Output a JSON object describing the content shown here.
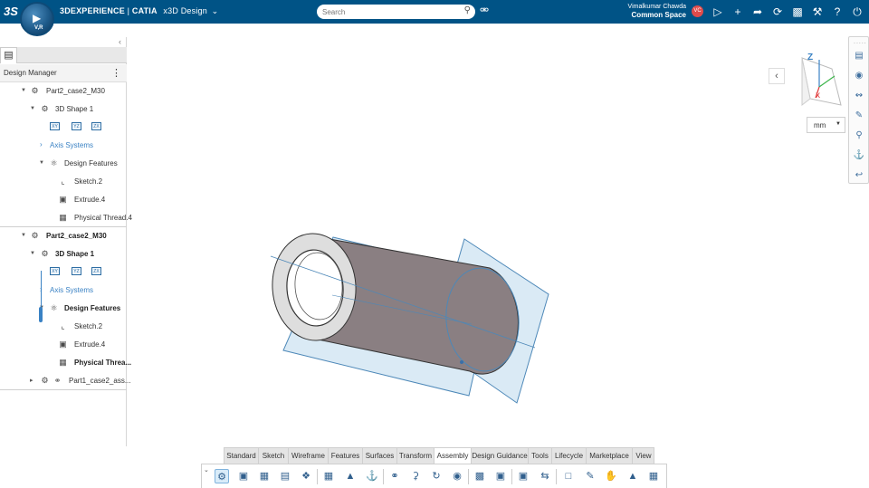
{
  "topbar": {
    "brand_app": "3DEXPERIENCE",
    "brand_sep": " | ",
    "brand_catia": "CATIA",
    "brand_role": "x3D Design",
    "brand_chevron": "⌄",
    "compass_version": "V,R",
    "search_placeholder": "Search",
    "user_name": "Vimalkumar Chawda",
    "user_space": "Common Space",
    "avatar_initials": "VC",
    "icons": [
      "tag-icon",
      "share-icon",
      "plus-icon",
      "forward-icon",
      "network-icon",
      "clipboard-icon",
      "tools-icon",
      "help-icon",
      "power-icon"
    ]
  },
  "panel": {
    "title": "Design Manager",
    "tree_top": [
      {
        "label": "Part2_case2_M30",
        "icon": "part-icon"
      },
      {
        "label": "3D Shape 1",
        "icon": "shape-icon"
      },
      {
        "label": "Axis Systems",
        "icon": "chevron-right"
      },
      {
        "label": "Design Features",
        "icon": "features-icon"
      },
      {
        "label": "Sketch.2",
        "icon": "sketch-icon"
      },
      {
        "label": "Extrude.4",
        "icon": "extrude-icon"
      },
      {
        "label": "Physical Thread.4",
        "icon": "thread-icon"
      }
    ],
    "tree_bottom": [
      {
        "label": "Part2_case2_M30",
        "icon": "part-icon"
      },
      {
        "label": "3D Shape 1",
        "icon": "shape-icon"
      },
      {
        "label": "Axis Systems",
        "icon": "chevron-right"
      },
      {
        "label": "Design Features",
        "icon": "features-icon"
      },
      {
        "label": "Sketch.2",
        "icon": "sketch-icon"
      },
      {
        "label": "Extrude.4",
        "icon": "extrude-icon"
      },
      {
        "label": "Physical Threa...",
        "icon": "thread-icon"
      },
      {
        "label": "Part1_case2_ass...",
        "icon": "assembly-icon"
      }
    ],
    "planes": [
      "XY",
      "YZ",
      "ZX"
    ]
  },
  "viewport": {
    "unit": "mm",
    "axis_z": "Z",
    "accent": "#3a82c4",
    "cylinder_color": "#8a7f82"
  },
  "tabs": [
    "Standard",
    "Sketch",
    "Wireframe",
    "Features",
    "Surfaces",
    "Transform",
    "Assembly",
    "Design Guidance",
    "Tools",
    "Lifecycle",
    "Marketplace",
    "View"
  ],
  "active_tab": "Assembly"
}
